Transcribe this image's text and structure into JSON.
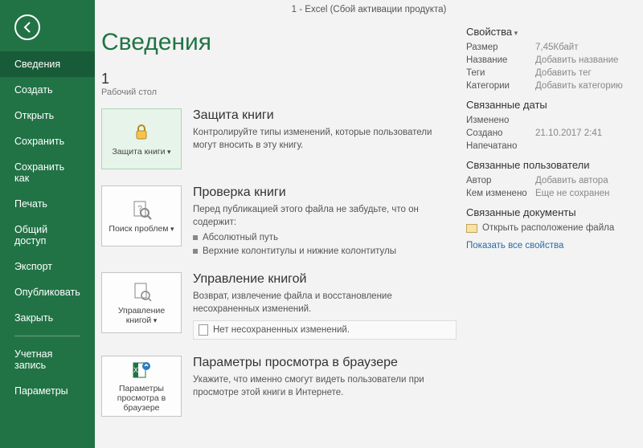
{
  "titlebar": "1 - Excel (Сбой активации продукта)",
  "page_title": "Сведения",
  "doc_name": "1",
  "doc_path": "Рабочий стол",
  "sidebar": {
    "items": [
      "Сведения",
      "Создать",
      "Открыть",
      "Сохранить",
      "Сохранить как",
      "Печать",
      "Общий доступ",
      "Экспорт",
      "Опубликовать",
      "Закрыть"
    ],
    "footer": [
      "Учетная запись",
      "Параметры"
    ]
  },
  "sections": {
    "protect": {
      "btn": "Защита книги",
      "title": "Защита книги",
      "desc": "Контролируйте типы изменений, которые пользователи могут вносить в эту книгу."
    },
    "inspect": {
      "btn": "Поиск проблем",
      "title": "Проверка книги",
      "desc": "Перед публикацией этого файла не забудьте, что он содержит:",
      "bul1": "Абсолютный путь",
      "bul2": "Верхние колонтитулы и нижние колонтитулы"
    },
    "manage": {
      "btn": "Управление книгой",
      "title": "Управление книгой",
      "desc": "Возврат, извлечение файла и восстановление несохраненных изменений.",
      "note": "Нет несохраненных изменений."
    },
    "browser": {
      "btn": "Параметры просмотра в браузере",
      "title": "Параметры просмотра в браузере",
      "desc": "Укажите, что именно смогут видеть пользователи при просмотре этой книги в Интернете."
    }
  },
  "props": {
    "h_props": "Свойства",
    "size_k": "Размер",
    "size_v": "7,45Кбайт",
    "name_k": "Название",
    "name_v": "Добавить название",
    "tags_k": "Теги",
    "tags_v": "Добавить тег",
    "cats_k": "Категории",
    "cats_v": "Добавить категорию",
    "h_dates": "Связанные даты",
    "mod_k": "Изменено",
    "mod_v": "",
    "cre_k": "Создано",
    "cre_v": "21.10.2017 2:41",
    "prn_k": "Напечатано",
    "prn_v": "",
    "h_users": "Связанные пользователи",
    "auth_k": "Автор",
    "auth_v": "Добавить автора",
    "lmod_k": "Кем изменено",
    "lmod_v": "Еще не сохранен",
    "h_docs": "Связанные документы",
    "open_loc": "Открыть расположение файла",
    "show_all": "Показать все свойства"
  }
}
